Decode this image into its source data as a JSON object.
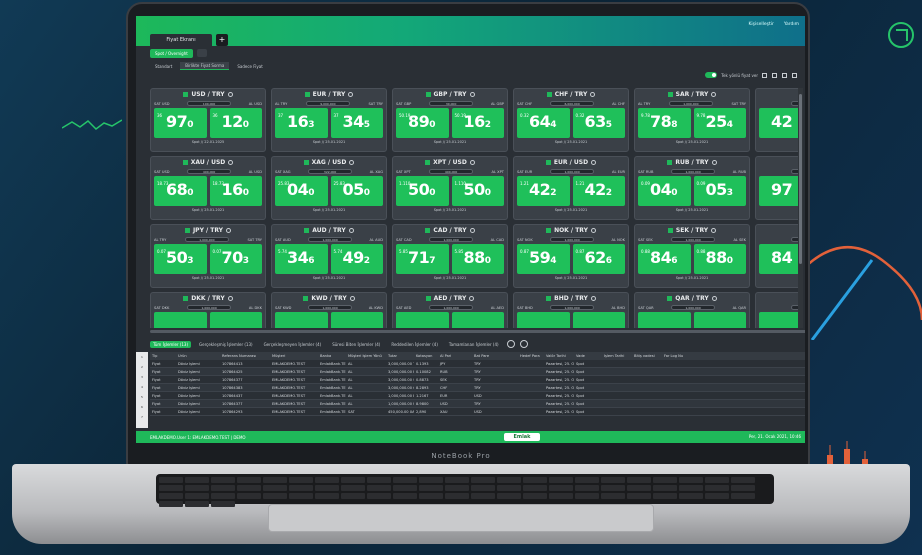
{
  "window": {
    "active_tab": "Fiyat Ekranı",
    "add_tab": "+",
    "user_links": [
      "Kişiselleştir",
      "Yardım"
    ]
  },
  "toolbar": {
    "spot_button": "Spot / Overnight",
    "views": [
      "Standart",
      "Birlikte Fiyat Sorma",
      "Sadece Fiyat"
    ],
    "toggle_label": "Tek yönlü fiyat ver"
  },
  "cards": [
    {
      "pair": "USD / TRY",
      "sell_label": "SAT USD",
      "buy_label": "AL USD",
      "amount": "100,000",
      "sell_small": "36",
      "sell_big": "97",
      "sell_sub": "0",
      "buy_small": "36",
      "buy_big": "12",
      "buy_sub": "0",
      "foot": "Spot // 22.01.2025"
    },
    {
      "pair": "EUR / TRY",
      "sell_label": "AL TRY",
      "buy_label": "SAT TRY",
      "amount": "9,000,000",
      "sell_small": "37",
      "sell_big": "16",
      "sell_sub": "3",
      "buy_small": "37",
      "buy_big": "34",
      "buy_sub": "5",
      "foot": "Spot // 25.01.2021"
    },
    {
      "pair": "GBP / TRY",
      "sell_label": "SAT GBP",
      "buy_label": "AL GBP",
      "amount": "30,000",
      "sell_small": "50.19",
      "sell_big": "89",
      "sell_sub": "0",
      "buy_small": "50.19",
      "buy_big": "16",
      "buy_sub": "2",
      "foot": "Spot // 25.01.2021"
    },
    {
      "pair": "CHF / TRY",
      "sell_label": "SAT CHF",
      "buy_label": "AL CHF",
      "amount": "6,000,000",
      "sell_small": "0.32",
      "sell_big": "64",
      "sell_sub": "4",
      "buy_small": "0.32",
      "buy_big": "63",
      "buy_sub": "5",
      "foot": "Spot // 25.01.2021"
    },
    {
      "pair": "SAR / TRY",
      "sell_label": "AL TRY",
      "buy_label": "SAT TRY",
      "amount": "1,000,000",
      "sell_small": "9.78",
      "sell_big": "78",
      "sell_sub": "8",
      "buy_small": "9.78",
      "buy_big": "25",
      "buy_sub": "4",
      "foot": "Spot // 25.01.2021"
    },
    {
      "pair": "",
      "sell_label": "",
      "buy_label": "",
      "amount": "",
      "sell_small": "",
      "sell_big": "42",
      "sell_sub": "",
      "buy_small": "",
      "buy_big": "",
      "buy_sub": "",
      "foot": ""
    },
    {
      "pair": "XAU / USD",
      "sell_label": "SAT USD",
      "buy_label": "AL USD",
      "amount": "400,000",
      "sell_small": "18.73",
      "sell_big": "68",
      "sell_sub": "0",
      "buy_small": "18.73",
      "buy_big": "16",
      "buy_sub": "0",
      "foot": "Spot // 25.01.2021"
    },
    {
      "pair": "XAG / USD",
      "sell_label": "SAT XAG",
      "buy_label": "AL XAG",
      "amount": "322,000",
      "sell_small": "25.83",
      "sell_big": "04",
      "sell_sub": "0",
      "buy_small": "25.83",
      "buy_big": "05",
      "buy_sub": "0",
      "foot": "Spot // 25.01.2021"
    },
    {
      "pair": "XPT / USD",
      "sell_label": "SAT XPT",
      "buy_label": "AL XPT",
      "amount": "400,000",
      "sell_small": "1.110",
      "sell_big": "50",
      "sell_sub": "0",
      "buy_small": "1.110",
      "buy_big": "50",
      "buy_sub": "0",
      "foot": "Spot // 25.01.2021"
    },
    {
      "pair": "EUR / USD",
      "sell_label": "SAT EUR",
      "buy_label": "AL EUR",
      "amount": "1,000,000",
      "sell_small": "1.21",
      "sell_big": "42",
      "sell_sub": "2",
      "buy_small": "1.21",
      "buy_big": "42",
      "buy_sub": "2",
      "foot": "Spot // 25.01.2021"
    },
    {
      "pair": "RUB / TRY",
      "sell_label": "SAT RUB",
      "buy_label": "AL RUB",
      "amount": "1,000,000",
      "sell_small": "0.09",
      "sell_big": "04",
      "sell_sub": "0",
      "buy_small": "0.09",
      "buy_big": "05",
      "buy_sub": "3",
      "foot": "Spot // 25.01.2021"
    },
    {
      "pair": "",
      "sell_label": "",
      "buy_label": "",
      "amount": "",
      "sell_small": "",
      "sell_big": "97",
      "sell_sub": "",
      "buy_small": "",
      "buy_big": "",
      "buy_sub": "",
      "foot": ""
    },
    {
      "pair": "JPY / TRY",
      "sell_label": "AL TRY",
      "buy_label": "SAT TRY",
      "amount": "1,000,000",
      "sell_small": "0.07",
      "sell_big": "50",
      "sell_sub": "3",
      "buy_small": "0.07",
      "buy_big": "70",
      "buy_sub": "3",
      "foot": "Spot // 25.01.2021"
    },
    {
      "pair": "AUD / TRY",
      "sell_label": "SAT AUD",
      "buy_label": "AL AUD",
      "amount": "1,000,000",
      "sell_small": "5.74",
      "sell_big": "34",
      "sell_sub": "6",
      "buy_small": "5.74",
      "buy_big": "49",
      "buy_sub": "2",
      "foot": "Spot // 25.01.2021"
    },
    {
      "pair": "CAD / TRY",
      "sell_label": "SAT CAD",
      "buy_label": "AL CAD",
      "amount": "1,000,000",
      "sell_small": "5.85",
      "sell_big": "71",
      "sell_sub": "7",
      "buy_small": "5.85",
      "buy_big": "88",
      "buy_sub": "0",
      "foot": "Spot // 25.01.2021"
    },
    {
      "pair": "NOK / TRY",
      "sell_label": "SAT NOK",
      "buy_label": "AL NOK",
      "amount": "1,000,000",
      "sell_small": "0.87",
      "sell_big": "59",
      "sell_sub": "4",
      "buy_small": "0.87",
      "buy_big": "62",
      "buy_sub": "6",
      "foot": "Spot // 25.01.2021"
    },
    {
      "pair": "SEK / TRY",
      "sell_label": "SAT SEK",
      "buy_label": "AL SEK",
      "amount": "1,000,000",
      "sell_small": "0.88",
      "sell_big": "84",
      "sell_sub": "6",
      "buy_small": "0.88",
      "buy_big": "88",
      "buy_sub": "0",
      "foot": "Spot // 25.01.2021"
    },
    {
      "pair": "",
      "sell_label": "",
      "buy_label": "",
      "amount": "",
      "sell_small": "",
      "sell_big": "84",
      "sell_sub": "",
      "buy_small": "",
      "buy_big": "",
      "buy_sub": "",
      "foot": ""
    },
    {
      "pair": "DKK / TRY",
      "sell_label": "SAT DKK",
      "buy_label": "AL DKK",
      "amount": "1,000,000",
      "sell_small": "",
      "sell_big": "",
      "sell_sub": "",
      "buy_small": "",
      "buy_big": "",
      "buy_sub": "",
      "foot": ""
    },
    {
      "pair": "KWD / TRY",
      "sell_label": "SAT KWD",
      "buy_label": "AL KWD",
      "amount": "1,000,000",
      "sell_small": "",
      "sell_big": "",
      "sell_sub": "",
      "buy_small": "",
      "buy_big": "",
      "buy_sub": "",
      "foot": ""
    },
    {
      "pair": "AED / TRY",
      "sell_label": "SAT AED",
      "buy_label": "AL AED",
      "amount": "1,000,000",
      "sell_small": "",
      "sell_big": "",
      "sell_sub": "",
      "buy_small": "",
      "buy_big": "",
      "buy_sub": "",
      "foot": ""
    },
    {
      "pair": "BHD / TRY",
      "sell_label": "SAT BHD",
      "buy_label": "AL BHD",
      "amount": "1,000,000",
      "sell_small": "",
      "sell_big": "",
      "sell_sub": "",
      "buy_small": "",
      "buy_big": "",
      "buy_sub": "",
      "foot": ""
    },
    {
      "pair": "QAR / TRY",
      "sell_label": "SAT QAR",
      "buy_label": "AL QAR",
      "amount": "1,000,000",
      "sell_small": "",
      "sell_big": "",
      "sell_sub": "",
      "buy_small": "",
      "buy_big": "",
      "buy_sub": "",
      "foot": ""
    },
    {
      "pair": "",
      "sell_label": "",
      "buy_label": "",
      "amount": "",
      "sell_small": "",
      "sell_big": "",
      "sell_sub": "",
      "buy_small": "",
      "buy_big": "",
      "buy_sub": "",
      "foot": ""
    }
  ],
  "bottom_tabs": [
    "Tüm İşlemler (13)",
    "Gerçekleşmiş İşlemler (13)",
    "Gerçekleşmeyen İşlemler (4)",
    "Süresi Biten İşlemler (4)",
    "Reddedilen İşlemler (4)",
    "Tamamlanan İşlemler (4)"
  ],
  "table": {
    "headers": [
      "Tip",
      "Ürün",
      "Referans Numarası",
      "Müşteri",
      "Banka",
      "Müşteri İşlem Yönü",
      "Tutar",
      "Kotasyon",
      "Al Pari",
      "Bat Pare",
      "Hedef Para",
      "Valör Tarihi",
      "Vade",
      "İşlem Tarihi",
      "Bitiş vadesi",
      "Far Log Nu"
    ],
    "rows": [
      [
        "Fiyat",
        "Döviz İşlemi",
        "107864413",
        "EMLAKDEMO.TEST",
        "EmlakBank.TEST",
        "AL",
        "3,000,000.00 TRY",
        "0.1393",
        "JPY",
        "TRY",
        "",
        "Pazartesi, 25. Ocak 2021",
        "Spot",
        "",
        ""
      ],
      [
        "Fiyat",
        "Döviz İşlemi",
        "107864425",
        "EMLAKDEMO.TEST",
        "EmlakBank.TEST",
        "AL",
        "3,000,000.00 RUB",
        "0.10082",
        "RUB",
        "TRY",
        "",
        "Pazartesi, 25. Ocak 2021",
        "Spot",
        "",
        ""
      ],
      [
        "Fiyat",
        "Döviz İşlemi",
        "107864377",
        "EMLAKDEMO.TEST",
        "EmlakBank.TEST",
        "AL",
        "3,000,000.00 SEK",
        "0.8873",
        "SEK",
        "TRY",
        "",
        "Pazartesi, 25. Ocak 2021",
        "Spot",
        "",
        ""
      ],
      [
        "Fiyat",
        "Döviz İşlemi",
        "107864383",
        "EMLAKDEMO.TEST",
        "EmlakBank.TEST",
        "AL",
        "3,000,000.00 CHF",
        "8.2893",
        "CHF",
        "TRY",
        "",
        "Pazartesi, 25. Ocak 2021",
        "Spot",
        "",
        ""
      ],
      [
        "Fiyat",
        "Döviz İşlemi",
        "107864437",
        "EMLAKDEMO.TEST",
        "EmlakBank.TEST",
        "AL",
        "1,000,000.00 EUR",
        "1.2167",
        "EUR",
        "USD",
        "",
        "Pazartesi, 25. Ocak 2021",
        "Spot",
        "",
        ""
      ],
      [
        "Fiyat",
        "Döviz İşlemi",
        "107864377",
        "EMLAKDEMO.TEST",
        "EmlakBank.TEST",
        "AL",
        "1,000,000.00 USD",
        "8.9800",
        "USD",
        "TRY",
        "",
        "Pazartesi, 25. Ocak 2021",
        "Spot",
        "",
        ""
      ],
      [
        "Fiyat",
        "Döviz İşlemi",
        "107864293",
        "EMLAKDEMO.TEST",
        "EmlakBank.TEST",
        "SAT",
        "450,000.00 XAU",
        "2,890",
        "XAU",
        "USD",
        "",
        "Pazartesi, 25. Ocak 2021",
        "Spot",
        "",
        ""
      ]
    ]
  },
  "status": {
    "left": "EMLAKDEMO.User 1: EMLAKDEMO.TEST  |  DEMO",
    "logo": "Emlak",
    "right": "Per, 21. Ocak 2021, 10:46"
  },
  "laptop": {
    "model": "NoteBook Pro"
  },
  "colors": {
    "accent": "#1fb85a",
    "price_bg": "#1fc05a",
    "panel": "#2a2f35"
  }
}
